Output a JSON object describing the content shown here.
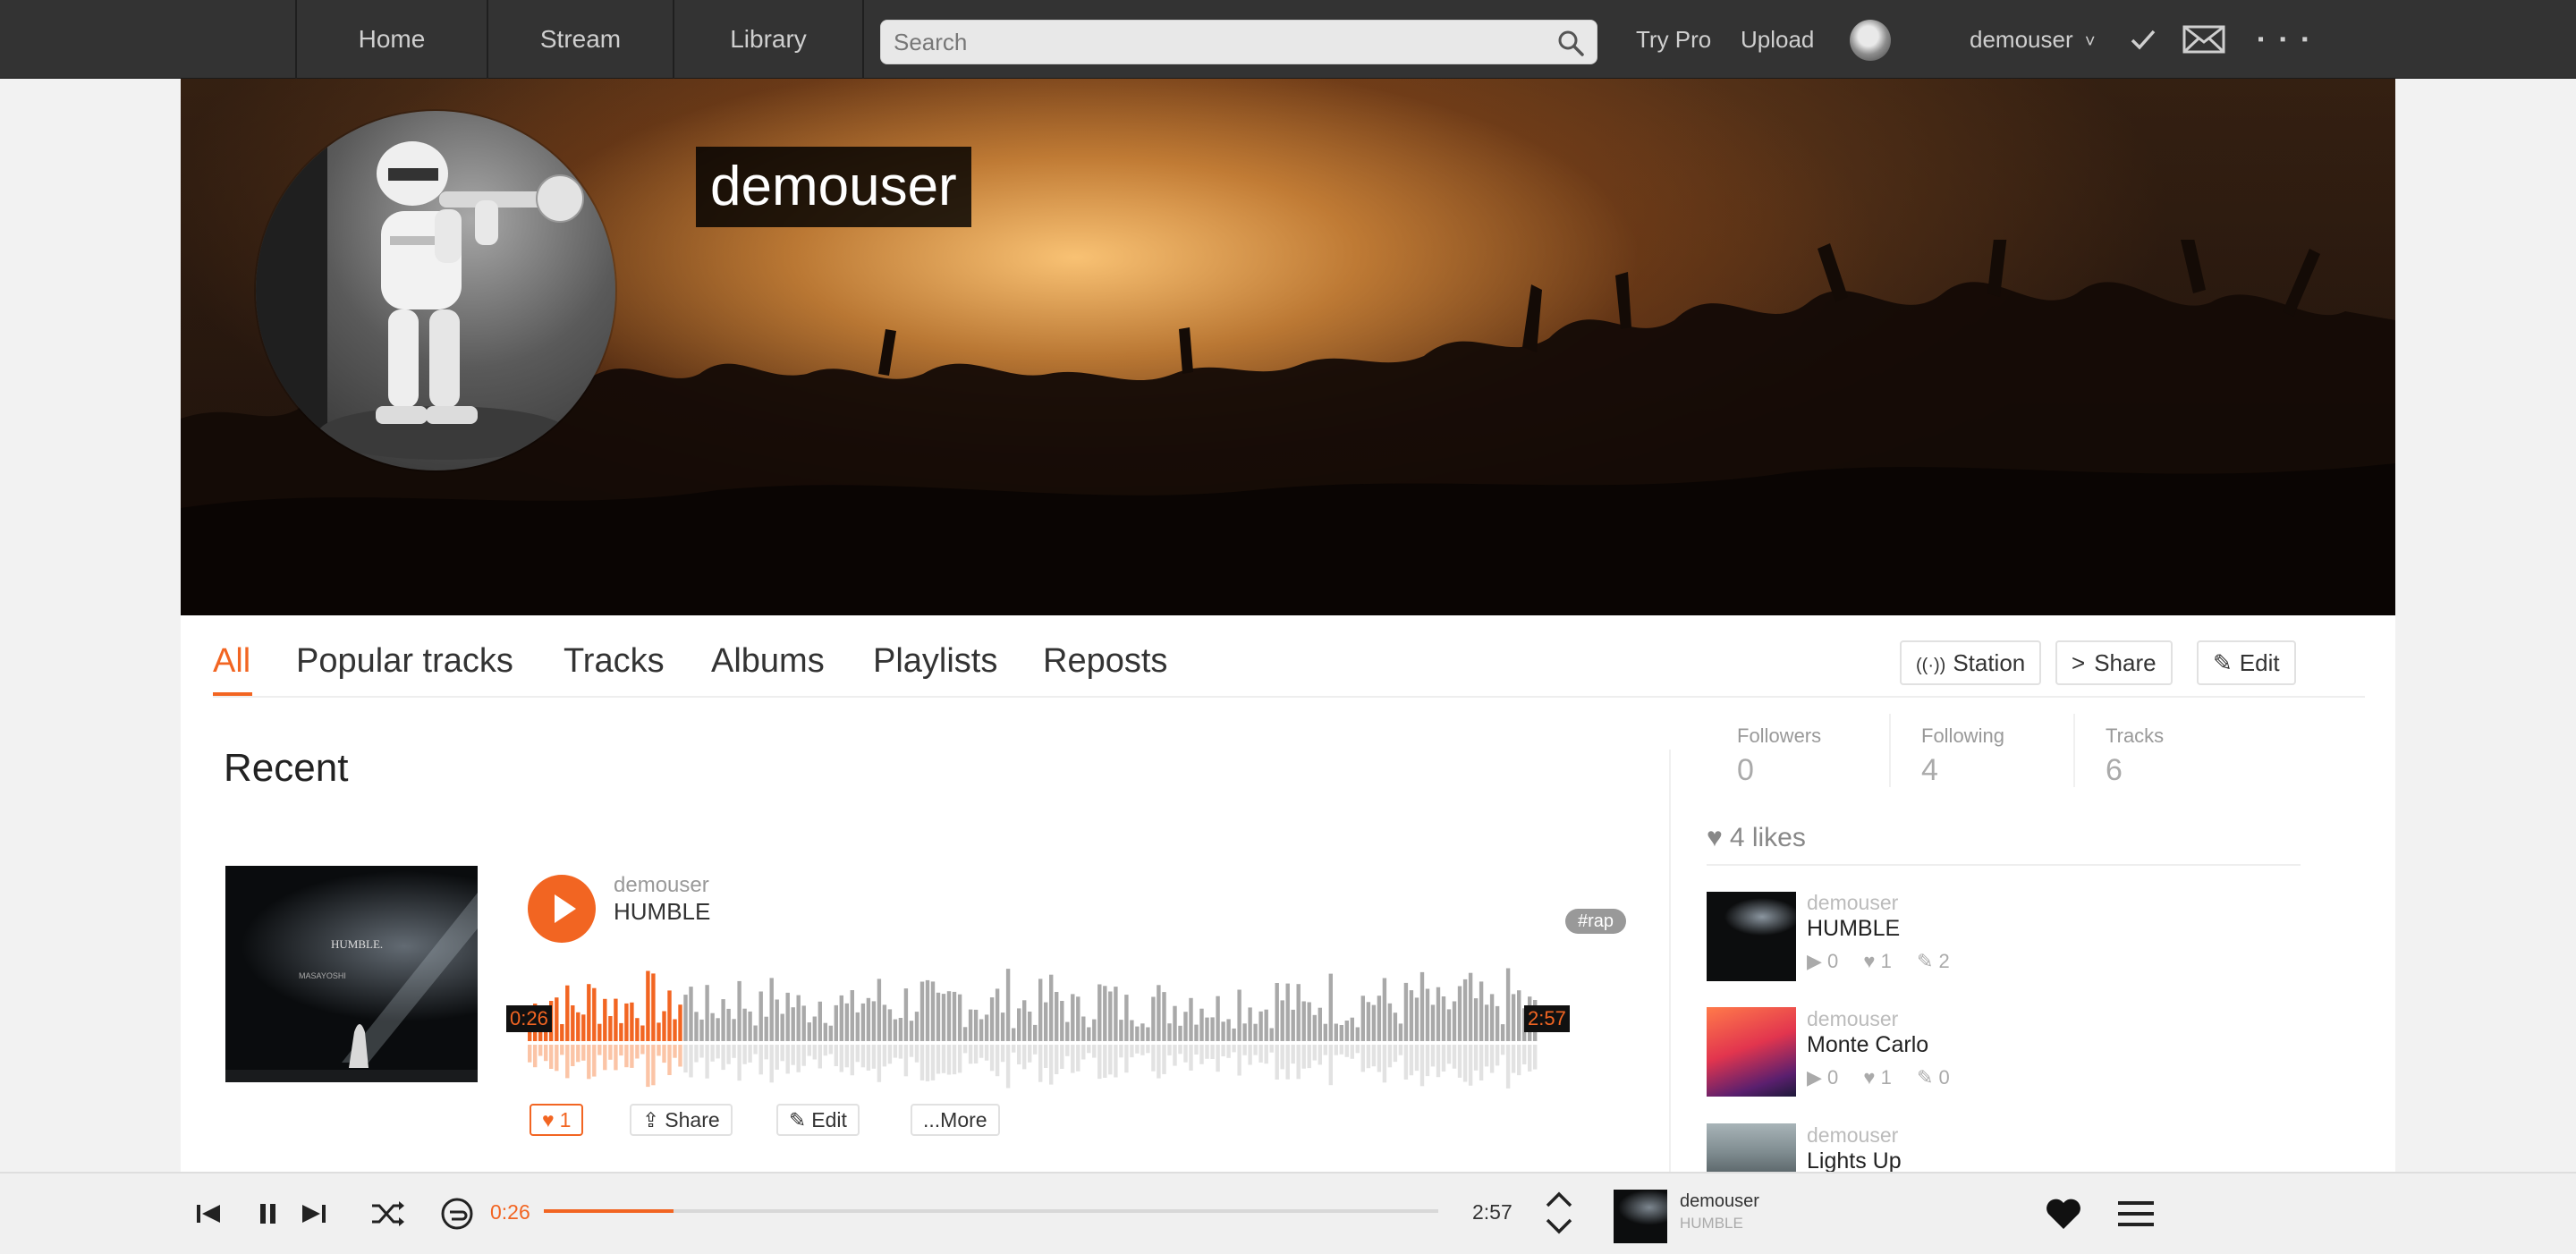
{
  "nav": {
    "home": "Home",
    "stream": "Stream",
    "library": "Library",
    "search_placeholder": "Search",
    "try_pro": "Try Pro",
    "upload": "Upload",
    "username": "demouser",
    "username_caret": "˅",
    "more": "▪ ▪ ▪"
  },
  "profile": {
    "name": "demouser"
  },
  "tabs": [
    "All",
    "Popular tracks",
    "Tracks",
    "Albums",
    "Playlists",
    "Reposts"
  ],
  "actions": {
    "station": "Station",
    "share": "Share",
    "edit": "Edit"
  },
  "recent": {
    "title": "Recent",
    "track": {
      "user": "demouser",
      "title": "HUMBLE",
      "art_title": "HUMBLE.",
      "art_artist": "MASAYOSHI",
      "tag": "#rap",
      "current_time": "0:26",
      "duration": "2:57",
      "progress": 0.15,
      "like_count": "1",
      "share_label": "Share",
      "edit_label": "Edit",
      "more_label": "...More"
    }
  },
  "stats": {
    "followers_label": "Followers",
    "followers": "0",
    "following_label": "Following",
    "following": "4",
    "tracks_label": "Tracks",
    "tracks": "6"
  },
  "likes": {
    "header": "4 likes",
    "items": [
      {
        "user": "demouser",
        "title": "HUMBLE",
        "plays": "0",
        "likes": "1",
        "comments": "2"
      },
      {
        "user": "demouser",
        "title": "Monte Carlo",
        "plays": "0",
        "likes": "1",
        "comments": "0"
      },
      {
        "user": "demouser",
        "title": "Lights Up"
      }
    ]
  },
  "player": {
    "current_time": "0:26",
    "duration": "2:57",
    "progress": 0.145,
    "user": "demouser",
    "title": "HUMBLE"
  },
  "colors": {
    "accent": "#f26522",
    "nav_bg": "#333333",
    "waveform_played": "#f26522",
    "waveform_unplayed": "#a9a9a9"
  }
}
